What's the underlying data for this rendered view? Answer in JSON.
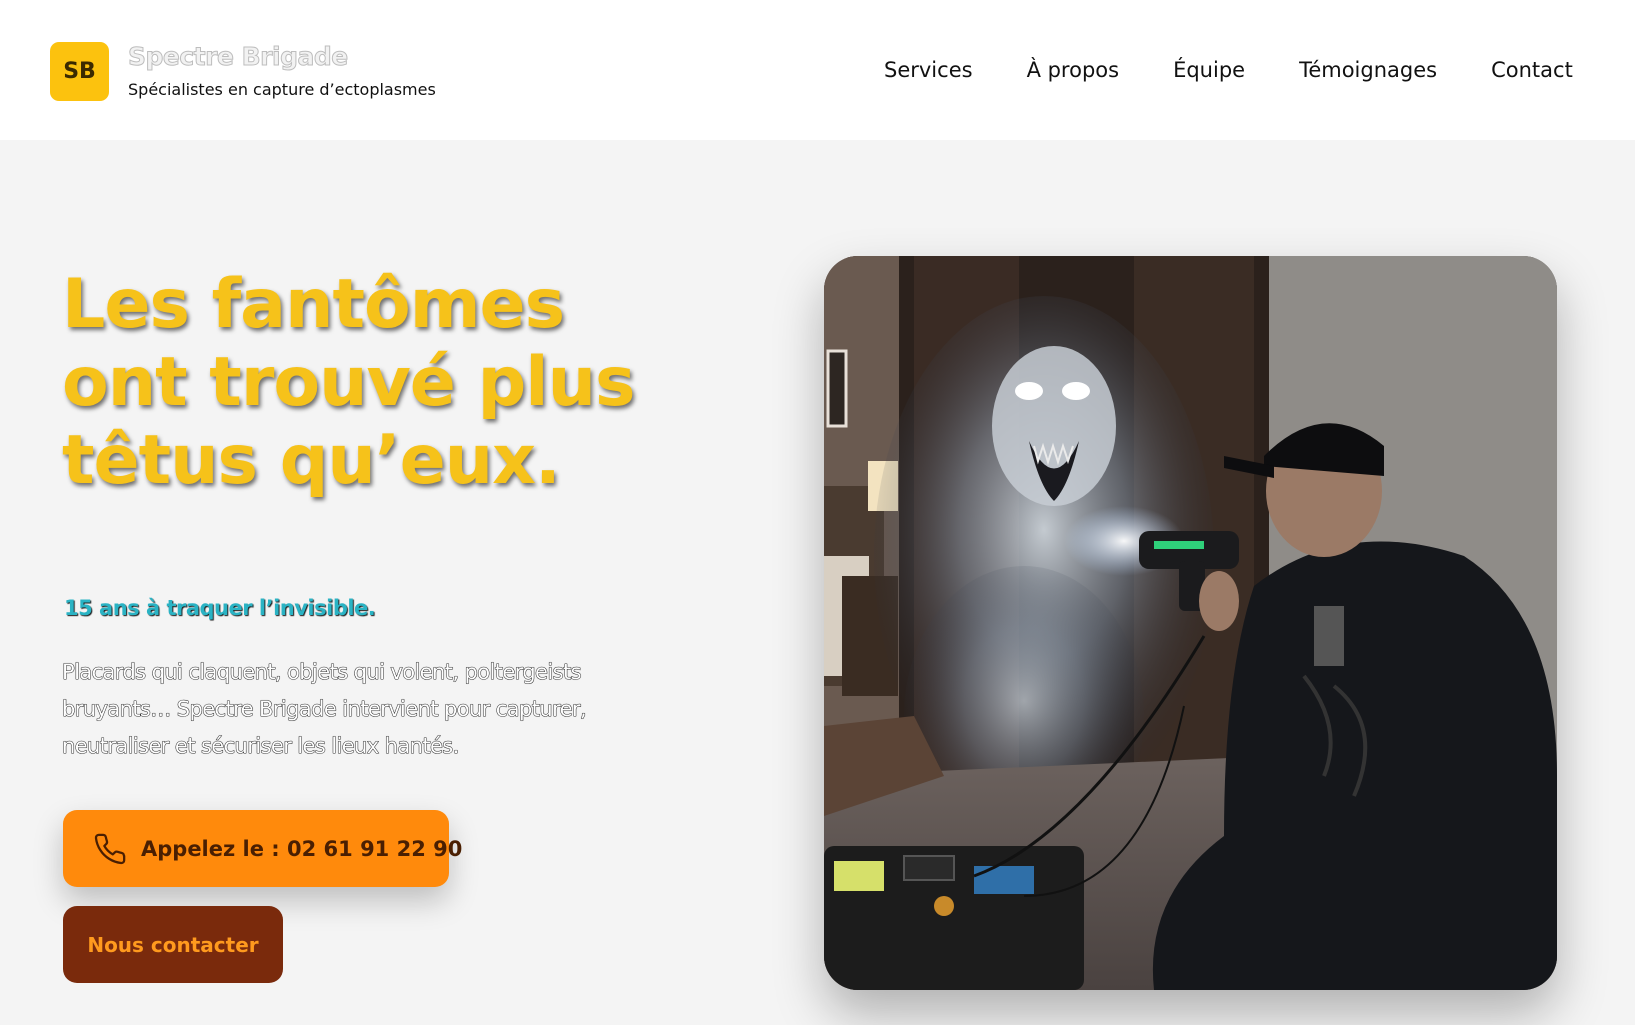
{
  "header": {
    "logo_initials": "SB",
    "brand_name": "Spectre Brigade",
    "brand_tagline": "Spécialistes en capture d’ectoplasmes",
    "nav": [
      {
        "label": "Services"
      },
      {
        "label": "À propos"
      },
      {
        "label": "Équipe"
      },
      {
        "label": "Témoignages"
      },
      {
        "label": "Contact"
      }
    ]
  },
  "hero": {
    "title": "Les fantômes ont trouvé plus têtus qu’eux.",
    "subtitle": "15 ans à traquer l’invisible.",
    "description": "Placards qui claquent, objets qui volent, poltergeists bruyants… Spectre Brigade intervient pour capturer, neutraliser et sécuriser les lieux hantés.",
    "call_button_label": "Appelez le : 02 61 91 22 90",
    "call_button_icon": "phone-icon",
    "contact_button_label": "Nous contacter",
    "image_subject": "ghost-hunter-photo"
  },
  "colors": {
    "accent_yellow": "#f6c21a",
    "accent_teal": "#2ab3c4",
    "call_button": "#ff8a0c",
    "contact_button": "#7a2a0c",
    "page_background": "#f4f4f4"
  }
}
